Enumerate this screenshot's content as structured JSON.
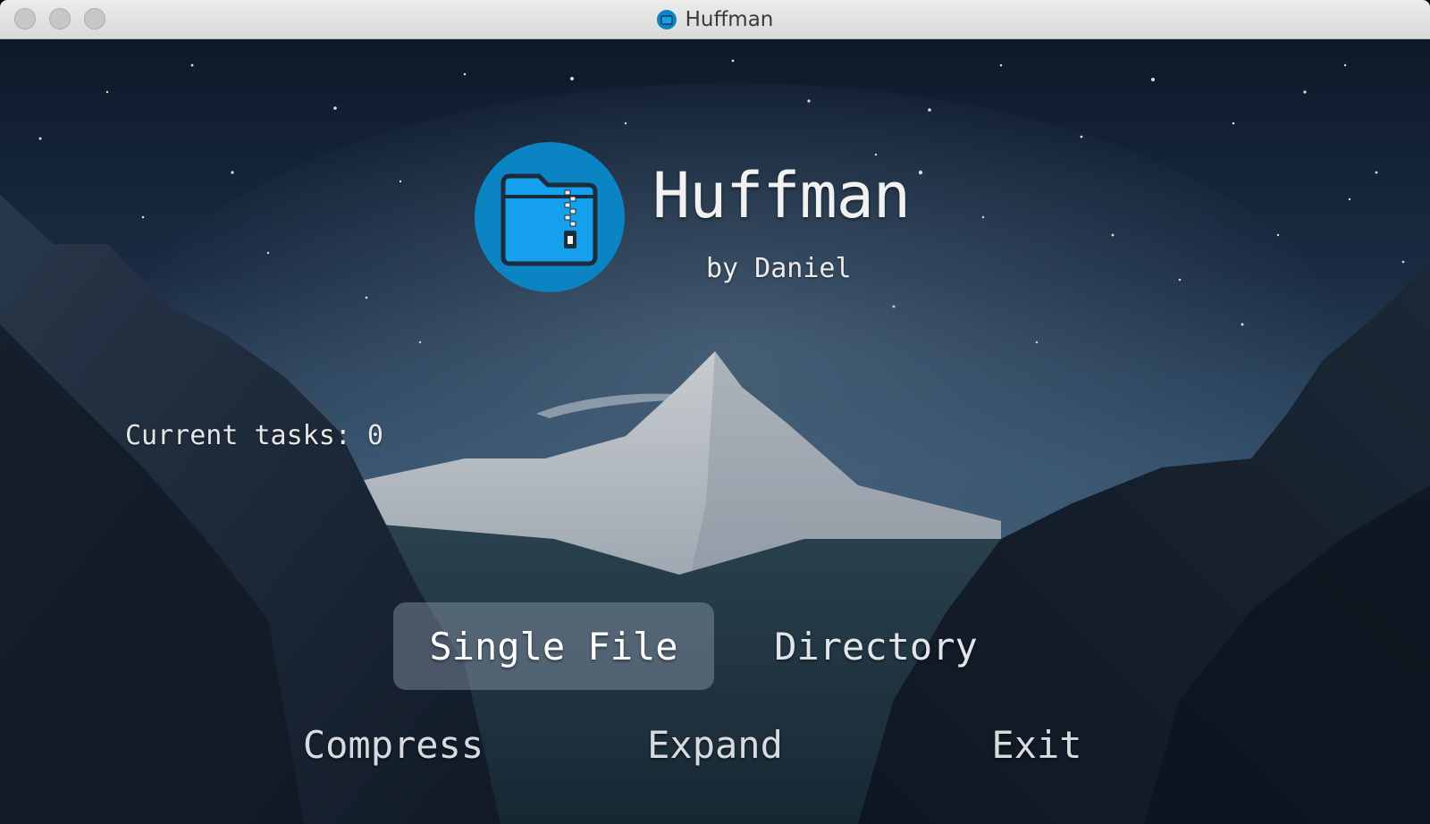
{
  "window": {
    "title": "Huffman"
  },
  "header": {
    "app_name": "Huffman",
    "author": "by Daniel"
  },
  "status": {
    "tasks_label": "Current tasks:",
    "tasks_count": "0"
  },
  "modes": [
    {
      "label": "Single File",
      "selected": true
    },
    {
      "label": "Directory",
      "selected": false
    }
  ],
  "actions": [
    {
      "label": "Compress"
    },
    {
      "label": "Expand"
    },
    {
      "label": "Exit"
    }
  ],
  "colors": {
    "logo_circle": "#0b84c4",
    "folder_fill": "#15a0ee",
    "folder_outline": "#1d2b3a"
  }
}
